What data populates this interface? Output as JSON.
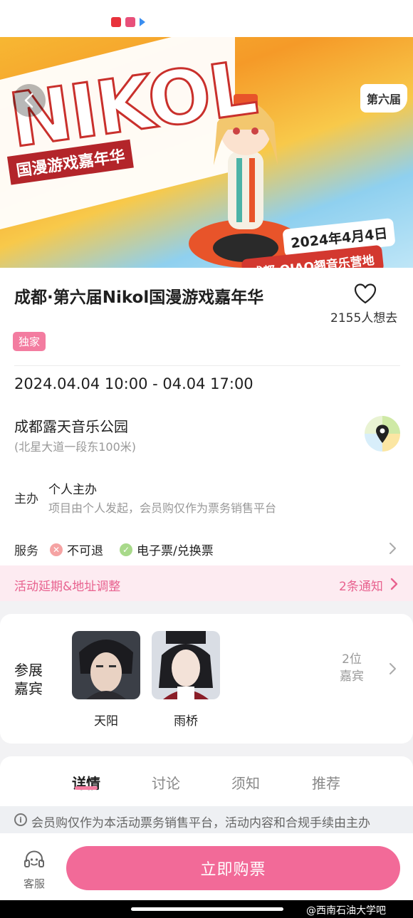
{
  "hero": {
    "title": "NIKOL",
    "subtitle": "国漫游戏嘉年华",
    "edition": "第六届",
    "date": "2024年4月4日",
    "venue": "成都·QIAO翘音乐营地"
  },
  "event": {
    "title": "成都·第六届Nikol国漫游戏嘉年华",
    "favorite_count": "2155人想去",
    "tag": "独家",
    "time": "2024.04.04 10:00 - 04.04 17:00",
    "venue_name": "成都露天音乐公园",
    "venue_address": "(北星大道一段东100米)"
  },
  "organizer": {
    "label": "主办",
    "name": "个人主办",
    "desc": "项目由个人发起，会员购仅作为票务销售平台"
  },
  "service": {
    "label": "服务",
    "items": [
      {
        "label": "不可退",
        "icon": "x-circle-icon",
        "color": "#f5a3a3"
      },
      {
        "label": "电子票/兑换票",
        "icon": "check-circle-icon",
        "color": "#a8d98a"
      }
    ]
  },
  "notice": {
    "text": "活动延期&地址调整",
    "link": "2条通知"
  },
  "guests": {
    "label": "参展嘉宾",
    "count_line1": "2位",
    "count_line2": "嘉宾",
    "items": [
      {
        "name": "天阳"
      },
      {
        "name": "雨桥"
      }
    ]
  },
  "tabs": [
    {
      "label": "详情",
      "active": true
    },
    {
      "label": "讨论",
      "active": false
    },
    {
      "label": "须知",
      "active": false
    },
    {
      "label": "推荐",
      "active": false
    }
  ],
  "disclaimer": "会员购仅作为本活动票务销售平台，活动内容和合规手续由主办",
  "bottom": {
    "cs_label": "客服",
    "buy_label": "立即购票"
  },
  "watermark": "@西南石油大学吧",
  "colors": {
    "accent": "#f26a98",
    "tag": "#f37ca0",
    "notice_bg": "#fdebf1"
  }
}
